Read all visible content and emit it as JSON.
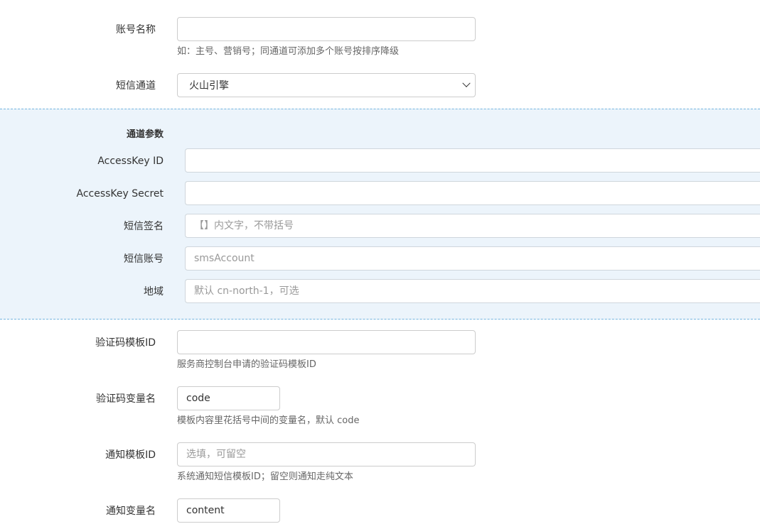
{
  "account_name": {
    "label": "账号名称",
    "value": "",
    "help": "如：主号、营销号；同通道可添加多个账号按排序降级"
  },
  "sms_channel": {
    "label": "短信通道",
    "selected": "火山引擎"
  },
  "channel_params": {
    "title": "通道参数",
    "access_key_id": {
      "label": "AccessKey ID",
      "value": "",
      "placeholder": ""
    },
    "access_key_secret": {
      "label": "AccessKey Secret",
      "value": "",
      "placeholder": ""
    },
    "sms_signature": {
      "label": "短信签名",
      "value": "",
      "placeholder": "【】内文字，不带括号"
    },
    "sms_account": {
      "label": "短信账号",
      "value": "",
      "placeholder": "smsAccount"
    },
    "region": {
      "label": "地域",
      "value": "",
      "placeholder": "默认 cn-north-1，可选"
    }
  },
  "verify_template_id": {
    "label": "验证码模板ID",
    "value": "",
    "help": "服务商控制台申请的验证码模板ID"
  },
  "verify_var_name": {
    "label": "验证码变量名",
    "value": "code",
    "help": "模板内容里花括号中间的变量名，默认 code"
  },
  "notify_template_id": {
    "label": "通知模板ID",
    "value": "",
    "placeholder": "选填，可留空",
    "help": "系统通知短信模板ID；留空则通知走纯文本"
  },
  "notify_var_name": {
    "label": "通知变量名",
    "value": "content"
  }
}
